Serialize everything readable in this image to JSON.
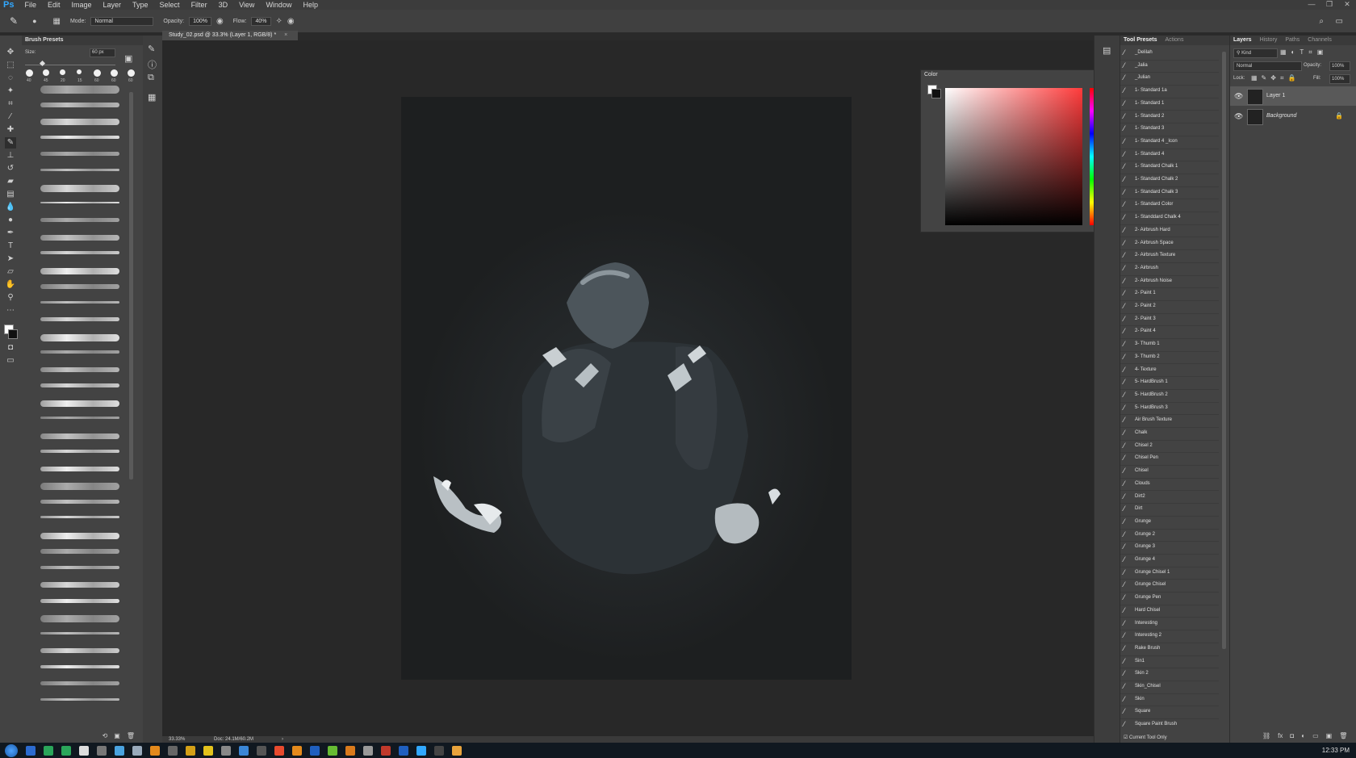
{
  "app": {
    "logo": "Ps"
  },
  "menu": [
    "File",
    "Edit",
    "Image",
    "Layer",
    "Type",
    "Select",
    "Filter",
    "3D",
    "View",
    "Window",
    "Help"
  ],
  "options_bar": {
    "mode_label": "Mode:",
    "mode_value": "Normal",
    "opacity_label": "Opacity:",
    "opacity_value": "100%",
    "flow_label": "Flow:",
    "flow_value": "40%"
  },
  "brush_presets": {
    "title": "Brush Presets",
    "size_label": "Size:",
    "size_value": "60 px",
    "tip_sizes": [
      "40",
      "45",
      "20",
      "15",
      "60",
      "60",
      "60"
    ]
  },
  "document": {
    "tab_title": "Study_02.psd @ 33.3% (Layer 1, RGB/8) *",
    "zoom": "33.33%",
    "doc_size": "Doc: 24.1M/60.2M"
  },
  "color_panel": {
    "title": "Color",
    "hue_color": "#ff3b3b"
  },
  "tool_presets": {
    "tabs": [
      "Tool Presets",
      "Actions"
    ],
    "items": [
      "_Delilah",
      "_Jalia",
      "_Julian",
      "1- Standard 1a",
      "1- Standard 1",
      "1- Standard 2",
      "1- Standard 3",
      "1- Standard 4 _Icon",
      "1- Standard 4",
      "1- Standard Chalk 1",
      "1- Standard Chalk 2",
      "1- Standard Chalk 3",
      "1- Standard Color",
      "1- Standdard Chalk 4",
      "2- Airbrush Hard",
      "2- Airbrush Space",
      "2- Airbrush Texture",
      "2- Airbrush",
      "2- Airbrush Noise",
      "2- Paint 1",
      "2- Paint 2",
      "2- Paint 3",
      "2- Paint 4",
      "3- Thumb 1",
      "3- Thumb 2",
      "4- Texture",
      "5- HardBrush 1",
      "5- HardBrush 2",
      "5- HardBrush 3",
      "Air Brush Texture",
      "Chalk",
      "Chisel 2",
      "Chisel Pen",
      "Chisel",
      "Clouds",
      "Dirt2",
      "Dirt",
      "Grunge",
      "Grunge 2",
      "Grunge 3",
      "Grunge 4",
      "Grunge Chisel 1",
      "Grunge Chisel",
      "Grunge Pen",
      "Hard Chisel",
      "Interesting",
      "Interesting 2",
      "Rake Brush",
      "Sin1",
      "Skin 2",
      "Skin_Chisel",
      "Skin",
      "Square",
      "Square Paint Brush"
    ],
    "footer": "Current Tool Only"
  },
  "layers_panel": {
    "tabs": [
      "Layers",
      "History",
      "Paths",
      "Channels"
    ],
    "kind": "Kind",
    "blend_mode": "Normal",
    "opacity_label": "Opacity:",
    "opacity_value": "100%",
    "lock_label": "Lock:",
    "fill_label": "Fill:",
    "fill_value": "100%",
    "layers": [
      {
        "name": "Layer 1",
        "selected": true
      },
      {
        "name": "Background",
        "selected": false
      }
    ]
  },
  "taskbar": {
    "clock": "12:33 PM"
  }
}
